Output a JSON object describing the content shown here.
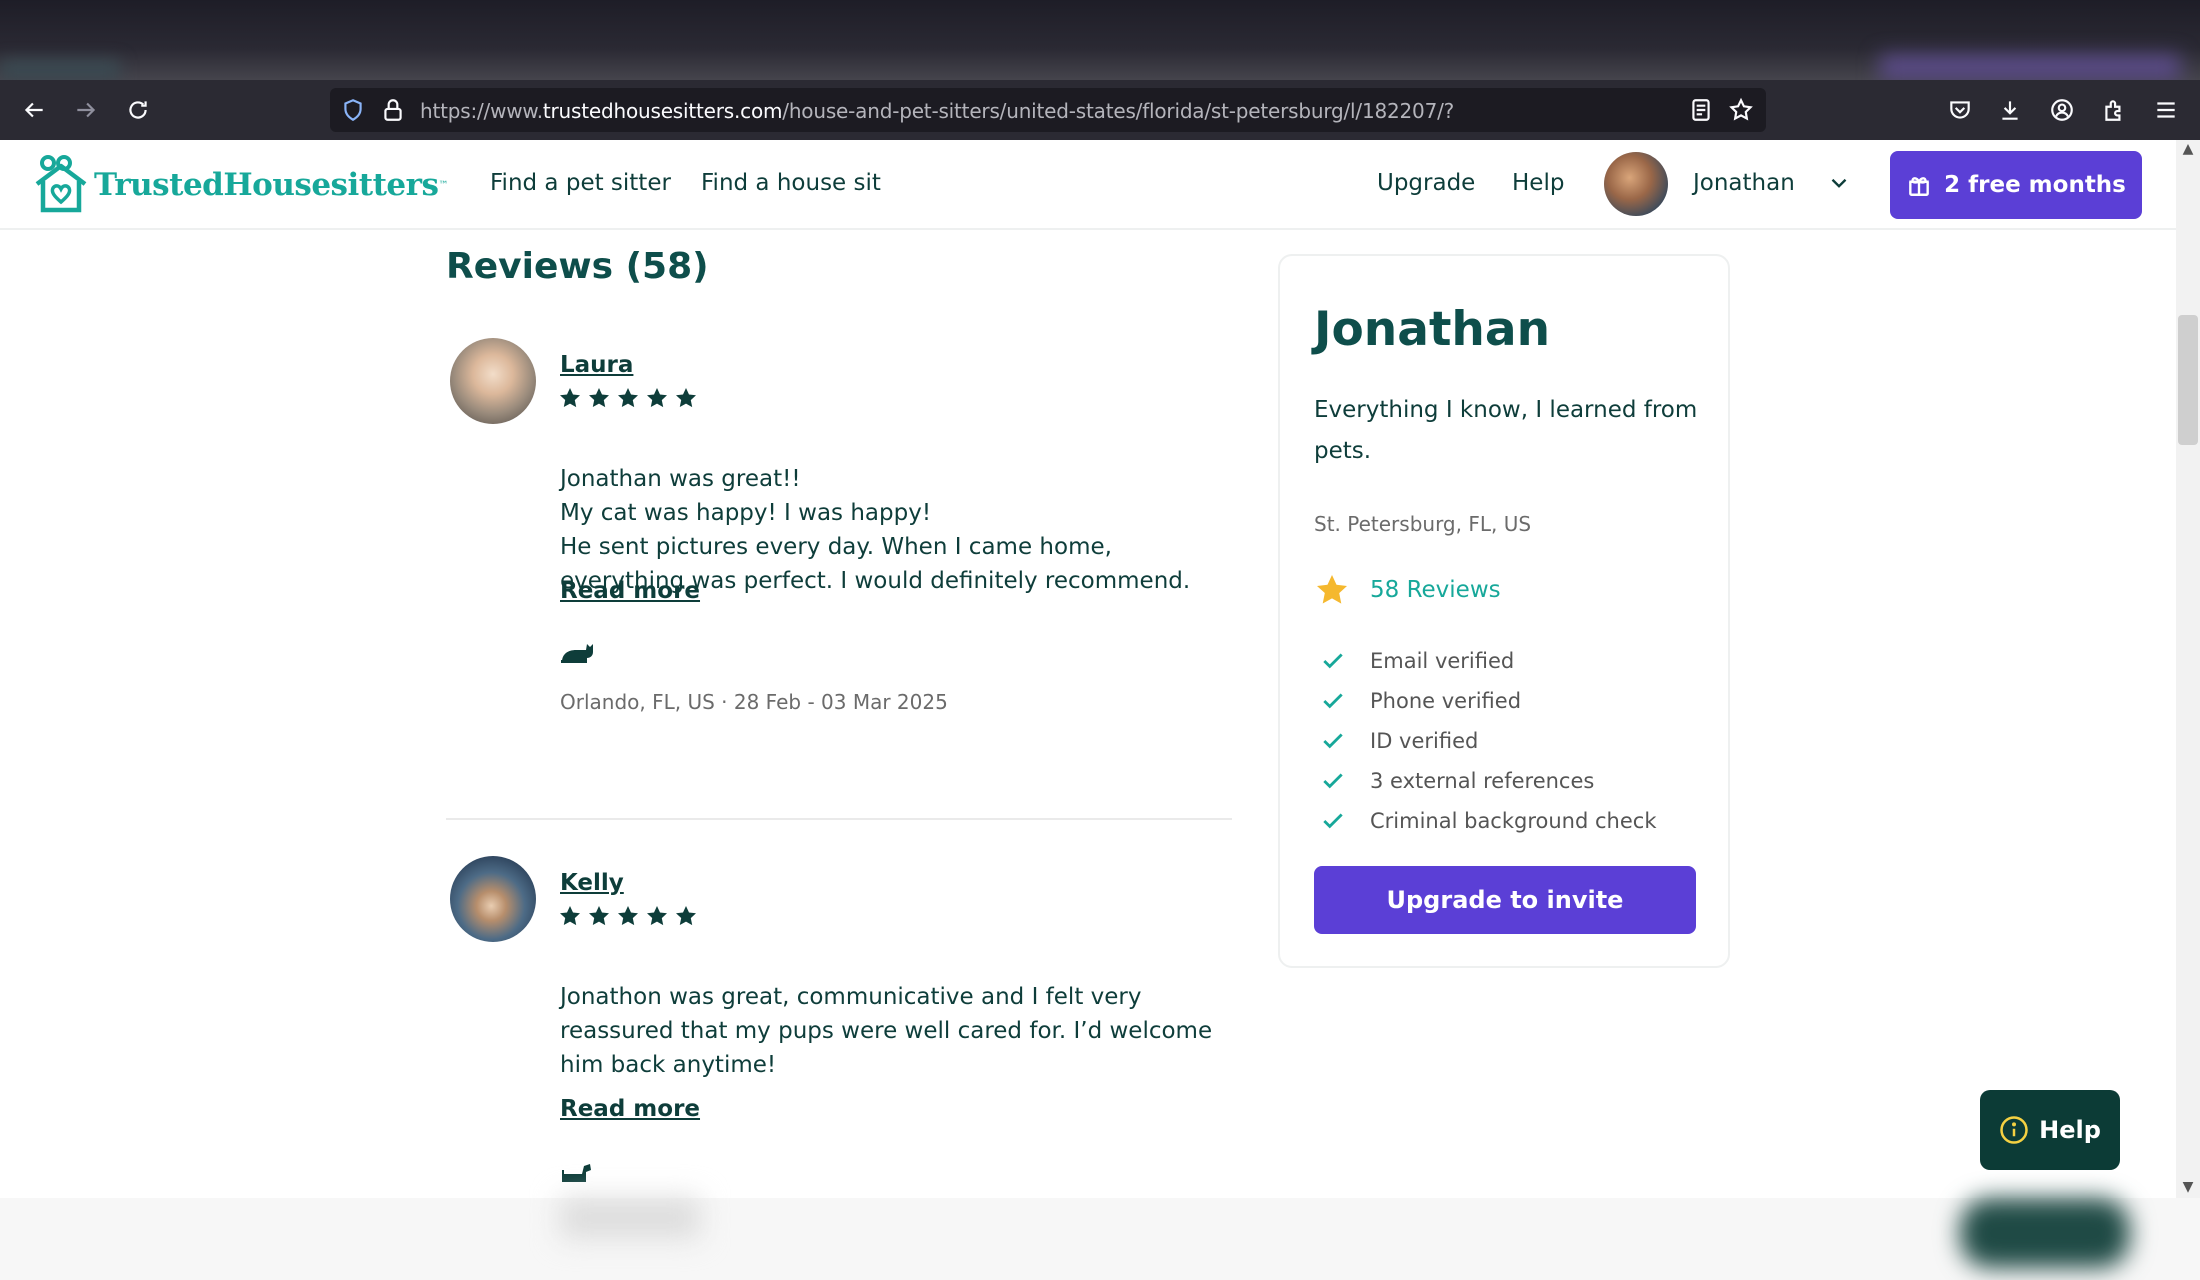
{
  "browser": {
    "url_prefix": "https://www.",
    "url_host": "trustedhousesitters.com",
    "url_path": "/house-and-pet-sitters/united-states/florida/st-petersburg/l/182207/?"
  },
  "header": {
    "logo_text": "TrustedHousesitters",
    "logo_tm": "™",
    "nav_find_sitter": "Find a pet sitter",
    "nav_find_sit": "Find a house sit",
    "nav_upgrade": "Upgrade",
    "nav_help": "Help",
    "user_name": "Jonathan",
    "promo_label": "2 free months"
  },
  "reviews": {
    "title": "Reviews (58)",
    "items": [
      {
        "name": "Laura",
        "rating": 5,
        "lines": [
          "Jonathan was great!!",
          "My cat was happy! I was happy!",
          "He sent pictures every day. When I came home, everything was perfect. I would definitely recommend."
        ],
        "read_more": "Read more",
        "meta": "Orlando, FL, US · 28 Feb - 03 Mar 2025"
      },
      {
        "name": "Kelly",
        "rating": 5,
        "lines": [
          "Jonathon was great, communicative and I felt very reassured that my pups were well cared for. I’d welcome him back anytime!"
        ],
        "read_more": "Read more"
      }
    ]
  },
  "card": {
    "name": "Jonathan",
    "tagline": "Everything I know, I learned from pets.",
    "location": "St. Petersburg, FL, US",
    "reviews_link": "58 Reviews",
    "verifications": [
      "Email verified",
      "Phone verified",
      "ID verified",
      "3 external references",
      "Criminal background check"
    ],
    "cta": "Upgrade to invite"
  },
  "help_widget": {
    "label": "Help"
  },
  "colors": {
    "brand_teal": "#17a89a",
    "dark_teal": "#0e3d3a",
    "cta_purple": "#5b3fd6",
    "star_gold": "#f5b82e"
  }
}
